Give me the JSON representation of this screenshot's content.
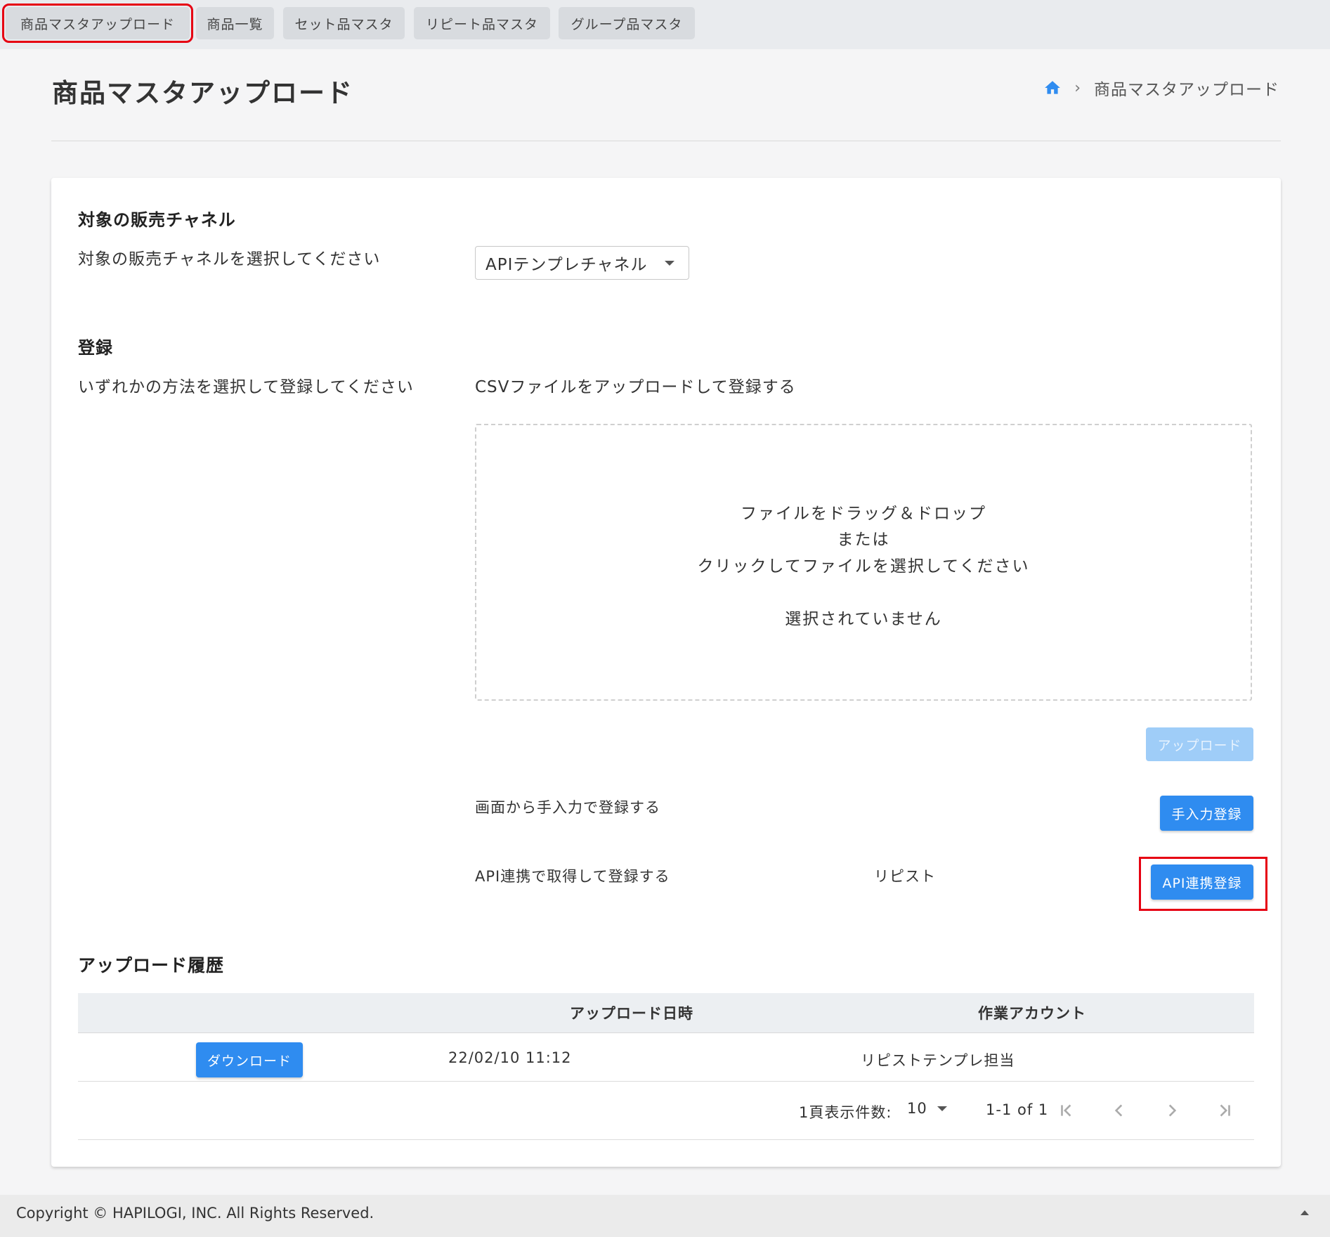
{
  "tabs": [
    {
      "label": "商品マスタアップロード",
      "active": true
    },
    {
      "label": "商品一覧",
      "active": false
    },
    {
      "label": "セット品マスタ",
      "active": false
    },
    {
      "label": "リピート品マスタ",
      "active": false
    },
    {
      "label": "グループ品マスタ",
      "active": false
    }
  ],
  "page": {
    "title": "商品マスタアップロード",
    "breadcrumb_current": "商品マスタアップロード",
    "breadcrumb_icon": "home-icon"
  },
  "channel": {
    "heading": "対象の販売チャネル",
    "description": "対象の販売チャネルを選択してください",
    "selected": "APIテンプレチャネル"
  },
  "register": {
    "heading": "登録",
    "description": "いずれかの方法を選択して登録してください",
    "csv_label": "CSVファイルをアップロードして登録する",
    "dropzone": {
      "line1": "ファイルをドラッグ＆ドロップ",
      "line2": "または",
      "line3": "クリックしてファイルを選択してください",
      "status": "選択されていません"
    },
    "upload_button": "アップロード",
    "manual_label": "画面から手入力で登録する",
    "manual_button": "手入力登録",
    "api_label": "API連携で取得して登録する",
    "api_target": "リピスト",
    "api_button": "API連携登録"
  },
  "history": {
    "heading": "アップロード履歴",
    "columns": [
      "",
      "アップロード日時",
      "作業アカウント"
    ],
    "rows": [
      {
        "action": "ダウンロード",
        "datetime": "22/02/10 11:12",
        "account": "リピストテンプレ担当"
      }
    ],
    "pager": {
      "rows_per_page_label": "1頁表示件数:",
      "rows_per_page": "10",
      "range": "1-1 of 1"
    }
  },
  "footer": {
    "copyright": "Copyright © HAPILOGI, INC. All Rights Reserved."
  },
  "colors": {
    "primary": "#2f8cf0",
    "highlight": "#e60012"
  }
}
